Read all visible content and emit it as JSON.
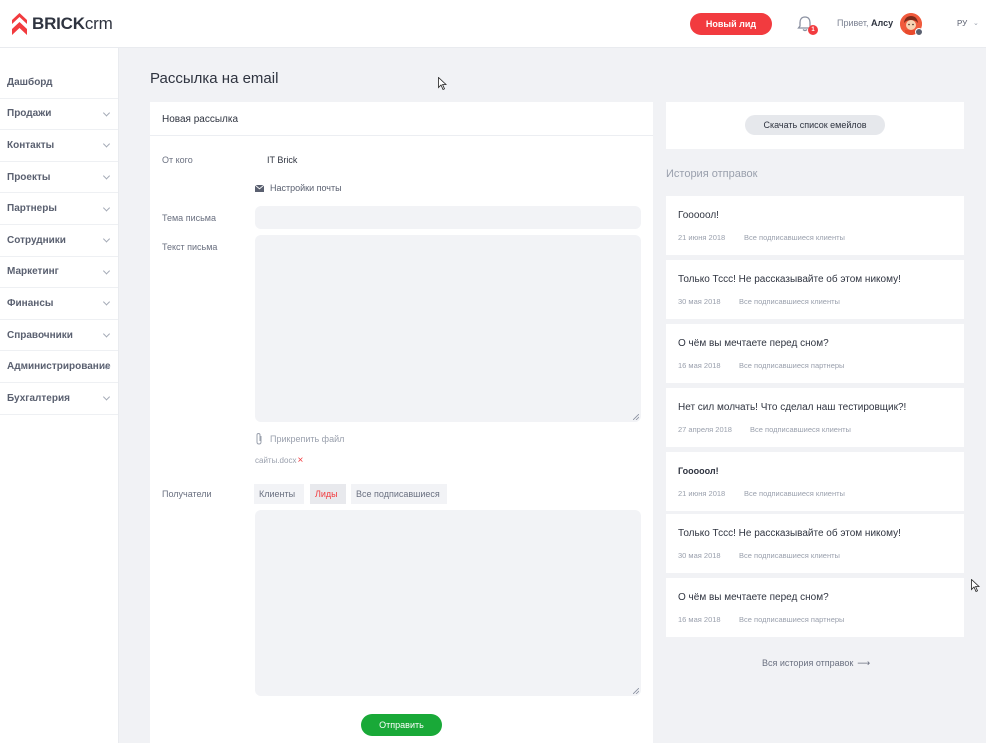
{
  "header": {
    "logo_bold": "BRICK",
    "logo_light": "crm",
    "new_lead_label": "Новый лид",
    "notification_count": "1",
    "greeting_prefix": "Привет,",
    "user_name": "Алсу",
    "language": "РУ",
    "accent_color": "#f23b3f"
  },
  "sidebar": {
    "items": [
      {
        "label": "Дашборд"
      },
      {
        "label": "Продажи"
      },
      {
        "label": "Контакты"
      },
      {
        "label": "Проекты"
      },
      {
        "label": "Партнеры"
      },
      {
        "label": "Сотрудники"
      },
      {
        "label": "Маркетинг"
      },
      {
        "label": "Финансы"
      },
      {
        "label": "Справочники"
      },
      {
        "label": "Администрирование"
      },
      {
        "label": "Бухгалтерия"
      }
    ]
  },
  "main": {
    "page_title": "Рассылка на email",
    "form": {
      "title": "Новая рассылка",
      "from_label": "От кого",
      "from_value": "IT Brick",
      "mail_settings_label": "Настройки почты",
      "subject_label": "Тема письма",
      "subject_value": "",
      "body_label": "Текст письма",
      "body_value": "",
      "attach_label": "Прикрепить файл",
      "attached_file": "сайты.docx",
      "remove_file_symbol": "×",
      "recipients_label": "Получатели",
      "recipient_tabs": [
        {
          "label": "Клиенты",
          "active": false
        },
        {
          "label": "Лиды",
          "active": true
        },
        {
          "label": "Все подписавшиеся",
          "active": false
        }
      ],
      "recipients_value": "",
      "send_label": "Отправить",
      "send_color": "#19a938"
    }
  },
  "right": {
    "download_label": "Скачать список емейлов",
    "history_title": "История отправок",
    "history": [
      {
        "subject": "Гооооол!",
        "date": "21 июня 2018",
        "audience": "Все подписавшиеся клиенты"
      },
      {
        "subject": "Только Тссс! Не рассказывайте об этом никому!",
        "date": "30 мая 2018",
        "audience": "Все подписавшиеся клиенты"
      },
      {
        "subject": "О чём вы мечтаете перед сном?",
        "date": "16 мая 2018",
        "audience": "Все подписавшиеся партнеры"
      },
      {
        "subject": "Нет сил молчать! Что сделал наш тестировщик?!",
        "date": "27 апреля 2018",
        "audience": "Все подписавшиеся клиенты"
      },
      {
        "subject": "Гооооол!",
        "date": "21 июня 2018",
        "audience": "Все подписавшиеся клиенты"
      },
      {
        "subject": "Только Тссс! Не рассказывайте об этом никому!",
        "date": "30 мая 2018",
        "audience": "Все подписавшиеся клиенты"
      },
      {
        "subject": "О чём вы мечтаете перед сном?",
        "date": "16 мая 2018",
        "audience": "Все подписавшиеся партнеры"
      }
    ],
    "all_history_label": "Вся история отправок",
    "arrow_symbol": "⟶"
  }
}
